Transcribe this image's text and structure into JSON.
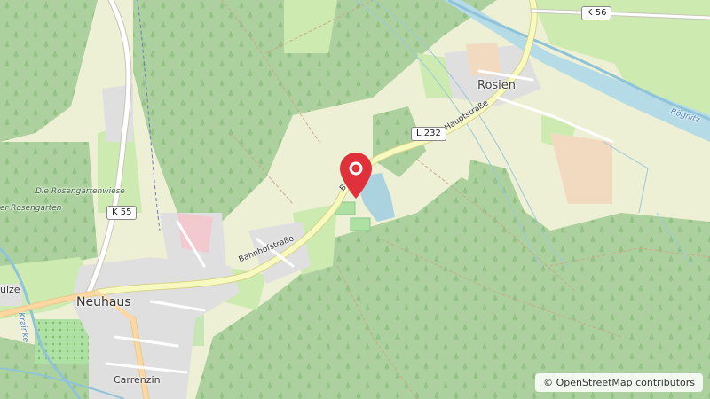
{
  "map": {
    "places": {
      "neuhaus": "Neuhaus",
      "rosien": "Rosien",
      "carrenzin": "Carrenzin",
      "sulze": "ülze",
      "rosengartenwiese": "Die Rosengartenwiese",
      "rosengarten": "er Rosengarten"
    },
    "roads": {
      "bahnhofstrasse": "Bahnhofstraße",
      "bahnhofstrasse_2": "B...straße",
      "hauptstrasse": "Hauptstraße",
      "l232": "L 232",
      "k55": "K 55",
      "k56": "K 56"
    },
    "waterways": {
      "rognitz": "Rögnitz",
      "krainke": "Krainke"
    },
    "marker": {
      "icon": "location-pin-icon",
      "color": "#e0303a"
    },
    "colors": {
      "forest": "#add19e",
      "farmland": "#eef0d5",
      "meadow": "#cdebb0",
      "residential": "#e0dfdf",
      "water": "#aad3df",
      "road_major": "#f7fabf",
      "road_minor": "#ffffff"
    }
  },
  "attribution": "© OpenStreetMap contributors"
}
